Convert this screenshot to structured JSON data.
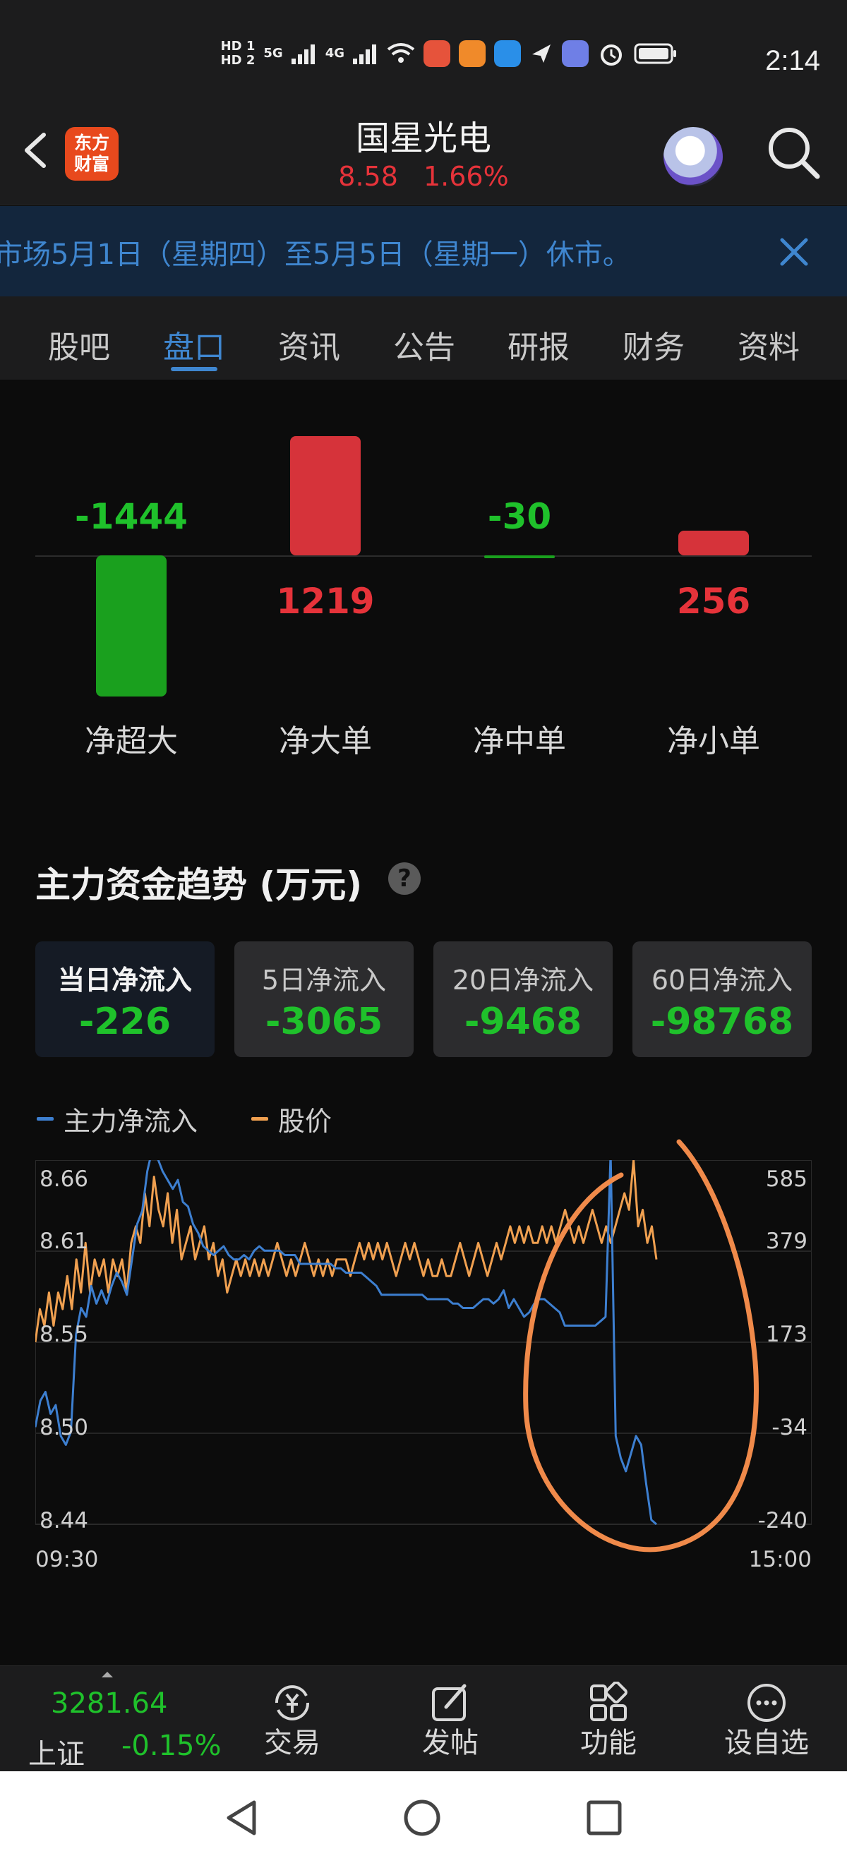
{
  "status_bar": {
    "time": "2:14",
    "badges": [
      "HD 1",
      "HD 2"
    ],
    "network": [
      "5G",
      "4G"
    ]
  },
  "header": {
    "logo_line1": "东方",
    "logo_line2": "财富",
    "stock_name": "国星光电",
    "price": "8.58",
    "change_pct": "1.66%"
  },
  "notice": {
    "text": "市场5月1日（星期四）至5月5日（星期一）休市。"
  },
  "tabs": [
    {
      "label": "股吧"
    },
    {
      "label": "盘口"
    },
    {
      "label": "资讯"
    },
    {
      "label": "公告"
    },
    {
      "label": "研报"
    },
    {
      "label": "财务"
    },
    {
      "label": "资料"
    }
  ],
  "fund_flow": {
    "items": [
      {
        "label": "净超大",
        "value": "-1444"
      },
      {
        "label": "净大单",
        "value": "1219"
      },
      {
        "label": "净中单",
        "value": "-30"
      },
      {
        "label": "净小单",
        "value": "256"
      }
    ],
    "values_num": [
      -1444,
      1219,
      -30,
      256
    ],
    "colors": {
      "positive": "#d6333a",
      "negative": "#1aa01e"
    }
  },
  "main_flow": {
    "title": "主力资金趋势 (万元)",
    "help": "?",
    "cards": [
      {
        "label": "当日净流入",
        "value": "-226"
      },
      {
        "label": "5日净流入",
        "value": "-3065"
      },
      {
        "label": "20日净流入",
        "value": "-9468"
      },
      {
        "label": "60日净流入",
        "value": "-98768"
      }
    ]
  },
  "legend": {
    "net_inflow": "主力净流入",
    "price": "股价"
  },
  "chart_data": {
    "type": "line",
    "x_start": "09:30",
    "x_end": "15:00",
    "left_ticks": [
      "8.66",
      "8.61",
      "8.55",
      "8.50",
      "8.44"
    ],
    "right_ticks": [
      "585",
      "379",
      "173",
      "-34",
      "-240"
    ],
    "price_range": [
      8.44,
      8.66
    ],
    "flow_range": [
      -240,
      585
    ],
    "series": [
      {
        "name": "股价",
        "color": "#f0a050",
        "values": [
          8.55,
          8.57,
          8.56,
          8.58,
          8.56,
          8.58,
          8.57,
          8.59,
          8.57,
          8.6,
          8.58,
          8.61,
          8.58,
          8.6,
          8.59,
          8.6,
          8.58,
          8.6,
          8.59,
          8.6,
          8.58,
          8.61,
          8.62,
          8.61,
          8.64,
          8.62,
          8.65,
          8.63,
          8.62,
          8.64,
          8.61,
          8.63,
          8.6,
          8.61,
          8.62,
          8.6,
          8.61,
          8.62,
          8.6,
          8.61,
          8.59,
          8.6,
          8.58,
          8.59,
          8.6,
          8.59,
          8.6,
          8.59,
          8.6,
          8.59,
          8.6,
          8.59,
          8.6,
          8.61,
          8.6,
          8.59,
          8.6,
          8.59,
          8.6,
          8.61,
          8.6,
          8.59,
          8.6,
          8.59,
          8.6,
          8.59,
          8.6,
          8.6,
          8.6,
          8.59,
          8.6,
          8.61,
          8.6,
          8.61,
          8.6,
          8.61,
          8.6,
          8.61,
          8.6,
          8.59,
          8.6,
          8.61,
          8.6,
          8.61,
          8.6,
          8.59,
          8.6,
          8.59,
          8.59,
          8.6,
          8.59,
          8.59,
          8.6,
          8.61,
          8.6,
          8.59,
          8.6,
          8.61,
          8.6,
          8.59,
          8.6,
          8.61,
          8.6,
          8.61,
          8.62,
          8.61,
          8.62,
          8.61,
          8.62,
          8.61,
          8.61,
          8.62,
          8.61,
          8.62,
          8.61,
          8.62,
          8.63,
          8.62,
          8.61,
          8.62,
          8.61,
          8.62,
          8.63,
          8.62,
          8.61,
          8.62,
          8.61,
          8.62,
          8.63,
          8.64,
          8.63,
          8.66,
          8.62,
          8.63,
          8.61,
          8.62,
          8.6
        ]
      },
      {
        "name": "主力净流入",
        "color": "#3d7fd0",
        "values": [
          -20,
          40,
          60,
          10,
          30,
          -40,
          -60,
          -30,
          190,
          250,
          230,
          300,
          260,
          290,
          260,
          300,
          330,
          310,
          280,
          360,
          440,
          470,
          560,
          610,
          590,
          560,
          540,
          520,
          540,
          490,
          480,
          440,
          420,
          390,
          380,
          370,
          380,
          390,
          370,
          360,
          360,
          370,
          360,
          380,
          390,
          380,
          380,
          380,
          380,
          370,
          370,
          370,
          350,
          350,
          350,
          350,
          350,
          350,
          350,
          340,
          340,
          330,
          330,
          330,
          330,
          320,
          310,
          300,
          280,
          280,
          280,
          280,
          280,
          280,
          280,
          280,
          280,
          270,
          270,
          270,
          270,
          270,
          260,
          260,
          250,
          250,
          250,
          260,
          270,
          270,
          260,
          270,
          290,
          250,
          270,
          250,
          230,
          240,
          260,
          270,
          270,
          260,
          250,
          240,
          210,
          210,
          210,
          210,
          210,
          210,
          210,
          220,
          230,
          600,
          -40,
          -90,
          -120,
          -80,
          -40,
          -60,
          -150,
          -230,
          -240
        ]
      }
    ]
  },
  "bottom_bar": {
    "index_value": "3281.64",
    "index_name": "上证",
    "index_change": "-0.15%",
    "nav": [
      {
        "label": "交易",
        "icon": "trade-icon"
      },
      {
        "label": "发帖",
        "icon": "compose-icon"
      },
      {
        "label": "功能",
        "icon": "grid-icon"
      },
      {
        "label": "设自选",
        "icon": "more-icon"
      }
    ]
  }
}
